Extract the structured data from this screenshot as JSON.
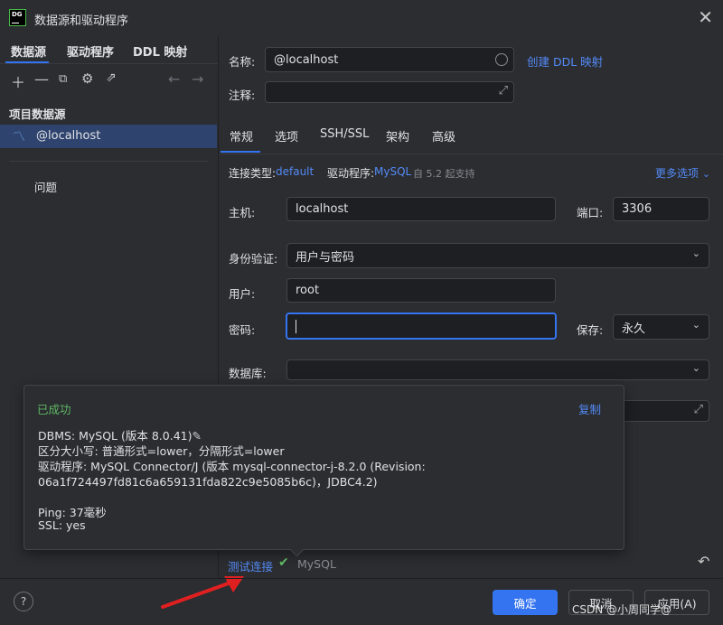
{
  "window": {
    "title": "数据源和驱动程序",
    "logo_text": "DG"
  },
  "left": {
    "tabs": [
      "数据源",
      "驱动程序",
      "DDL 映射"
    ],
    "section_title": "项目数据源",
    "datasource": "@localhost",
    "problems": "问题"
  },
  "form": {
    "name_label": "名称:",
    "name_value": "@localhost",
    "create_ddl": "创建 DDL 映射",
    "comment_label": "注释:",
    "tabs": [
      "常规",
      "选项",
      "SSH/SSL",
      "架构",
      "高级"
    ],
    "conn_type_label": "连接类型:",
    "conn_type_value": "default",
    "driver_label": "驱动程序:",
    "driver_value": "MySQL",
    "driver_note": "自 5.2 起支持",
    "more_options": "更多选项",
    "host_label": "主机:",
    "host_value": "localhost",
    "port_label": "端口:",
    "port_value": "3306",
    "auth_label": "身份验证:",
    "auth_value": "用户与密码",
    "user_label": "用户:",
    "user_value": "root",
    "password_label": "密码:",
    "save_label": "保存:",
    "save_value": "永久",
    "database_label": "数据库:"
  },
  "popup": {
    "status": "已成功",
    "copy": "复制",
    "lines": [
      "DBMS: MySQL (版本 8.0.41)",
      "区分大小写: 普通形式=lower，分隔形式=lower",
      "驱动程序: MySQL Connector/J (版本 mysql-connector-j-8.2.0 (Revision:",
      "06a1f724497fd81c6a659131fda822c9e5085b6c)，JDBC4.2)",
      "Ping: 37毫秒",
      "SSL: yes"
    ]
  },
  "bottom": {
    "test_connection": "测试连接",
    "test_status": "MySQL",
    "ok": "确定",
    "cancel": "取消",
    "apply": "应用(A)"
  },
  "watermark": "CSDN @小周同学@",
  "colors": {
    "accent": "#3574f0",
    "success": "#5fb865",
    "link": "#548af7",
    "arrow": "#e02020"
  }
}
